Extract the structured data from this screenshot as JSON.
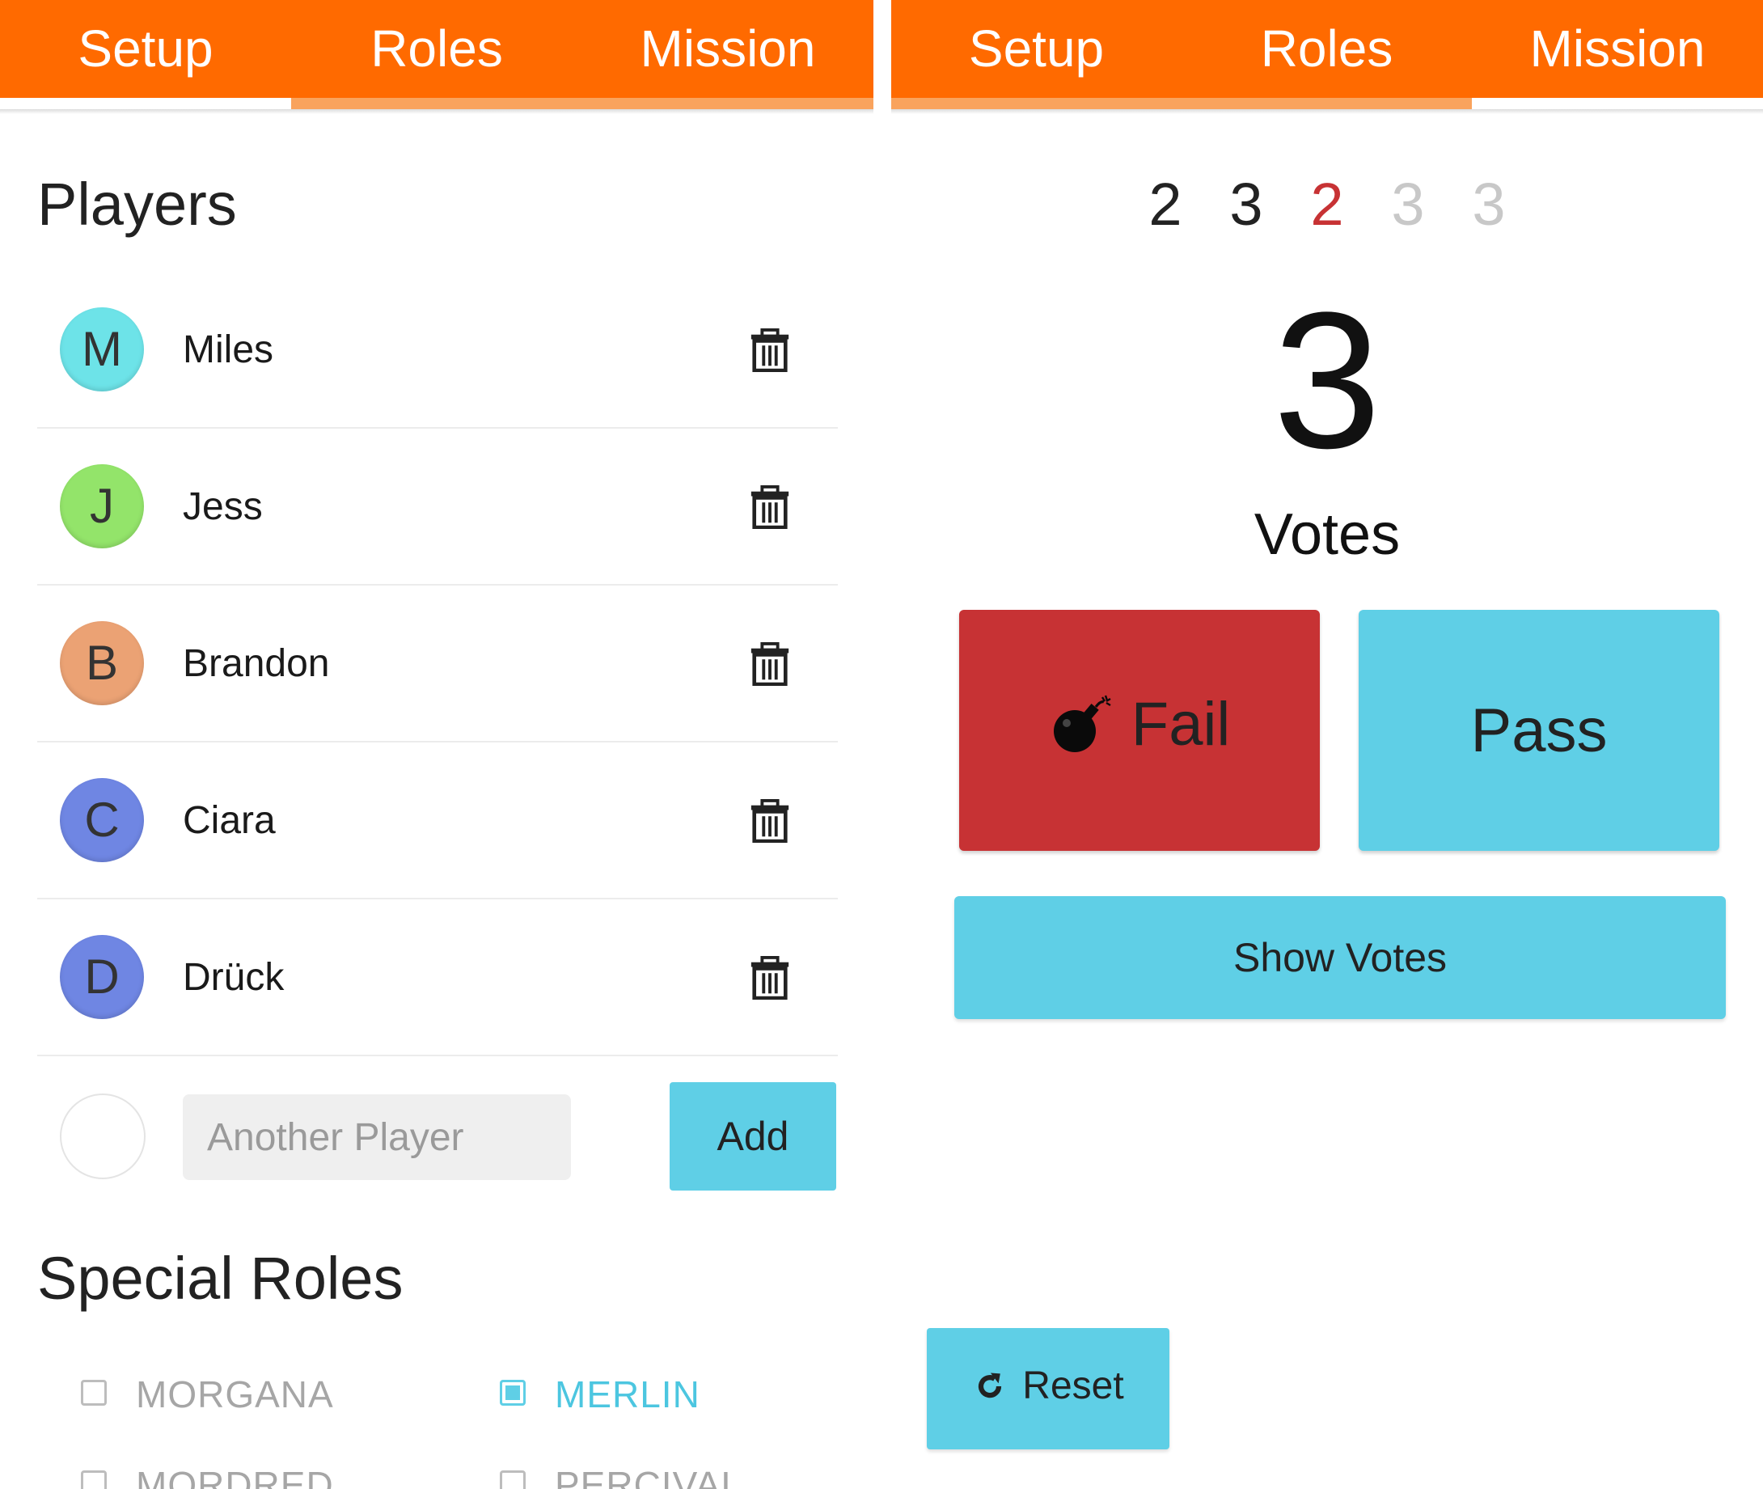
{
  "tabs": [
    "Setup",
    "Roles",
    "Mission"
  ],
  "setup": {
    "players_title": "Players",
    "players": [
      {
        "initial": "M",
        "name": "Miles",
        "color": "#6de3e8"
      },
      {
        "initial": "J",
        "name": "Jess",
        "color": "#93e46a"
      },
      {
        "initial": "B",
        "name": "Brandon",
        "color": "#eba274"
      },
      {
        "initial": "C",
        "name": "Ciara",
        "color": "#6f86e3"
      },
      {
        "initial": "D",
        "name": "Drück",
        "color": "#6f86e3"
      }
    ],
    "new_player_placeholder": "Another Player",
    "add_label": "Add",
    "special_roles_title": "Special Roles",
    "roles": [
      {
        "label": "MORGANA",
        "checked": false
      },
      {
        "label": "MERLIN",
        "checked": true
      },
      {
        "label": "MORDRED",
        "checked": false
      },
      {
        "label": "PERCIVAL",
        "checked": false
      }
    ]
  },
  "mission": {
    "tracker": [
      {
        "value": "2",
        "color": "#222222"
      },
      {
        "value": "3",
        "color": "#222222"
      },
      {
        "value": "2",
        "color": "#c73234"
      },
      {
        "value": "3",
        "color": "#c8c8c8"
      },
      {
        "value": "3",
        "color": "#c8c8c8"
      }
    ],
    "vote_count": "3",
    "votes_label": "Votes",
    "fail_label": "Fail",
    "pass_label": "Pass",
    "show_votes_label": "Show Votes",
    "reset_label": "Reset"
  },
  "colors": {
    "tab_bar": "#ff6a00",
    "tab_underline_active": "#ffffff",
    "tab_underline_inactive": "#f9a35d",
    "accent": "#5fcfe6",
    "fail": "#c73234"
  },
  "icons": [
    "trash-icon",
    "bomb-icon",
    "reset-icon"
  ]
}
